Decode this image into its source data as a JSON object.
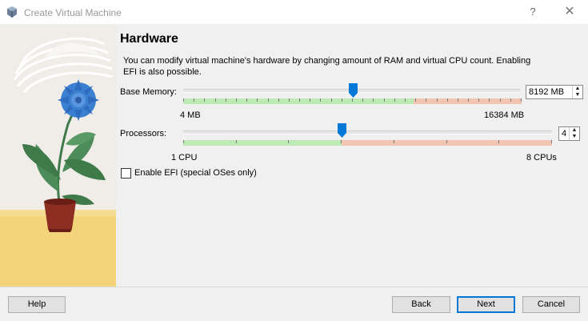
{
  "window": {
    "title": "Create Virtual Machine",
    "help_glyph": "?",
    "close_glyph": "✕"
  },
  "page": {
    "heading": "Hardware",
    "description": "You can modify virtual machine's hardware by changing amount of RAM and virtual CPU count. Enabling EFI is also possible."
  },
  "memory": {
    "label": "Base Memory:",
    "value_text": "8192 MB",
    "min_label": "4 MB",
    "max_label": "16384 MB",
    "value_fraction": 0.5,
    "recommended_fraction": 0.68
  },
  "processors": {
    "label": "Processors:",
    "value_text": "4",
    "min_label": "1 CPU",
    "max_label": "8 CPUs",
    "value_fraction": 0.43,
    "recommended_fraction": 0.43
  },
  "efi": {
    "label": "Enable EFI (special OSes only)",
    "checked": false
  },
  "buttons": {
    "help": "Help",
    "back": "Back",
    "next": "Next",
    "cancel": "Cancel"
  },
  "colors": {
    "accent": "#0078d7",
    "recommended_range": "#bde9b4",
    "excess_range": "#f2c4b2"
  },
  "icons": [
    "virtualbox-icon",
    "help-icon",
    "close-icon",
    "spin-up-icon",
    "spin-down-icon"
  ]
}
